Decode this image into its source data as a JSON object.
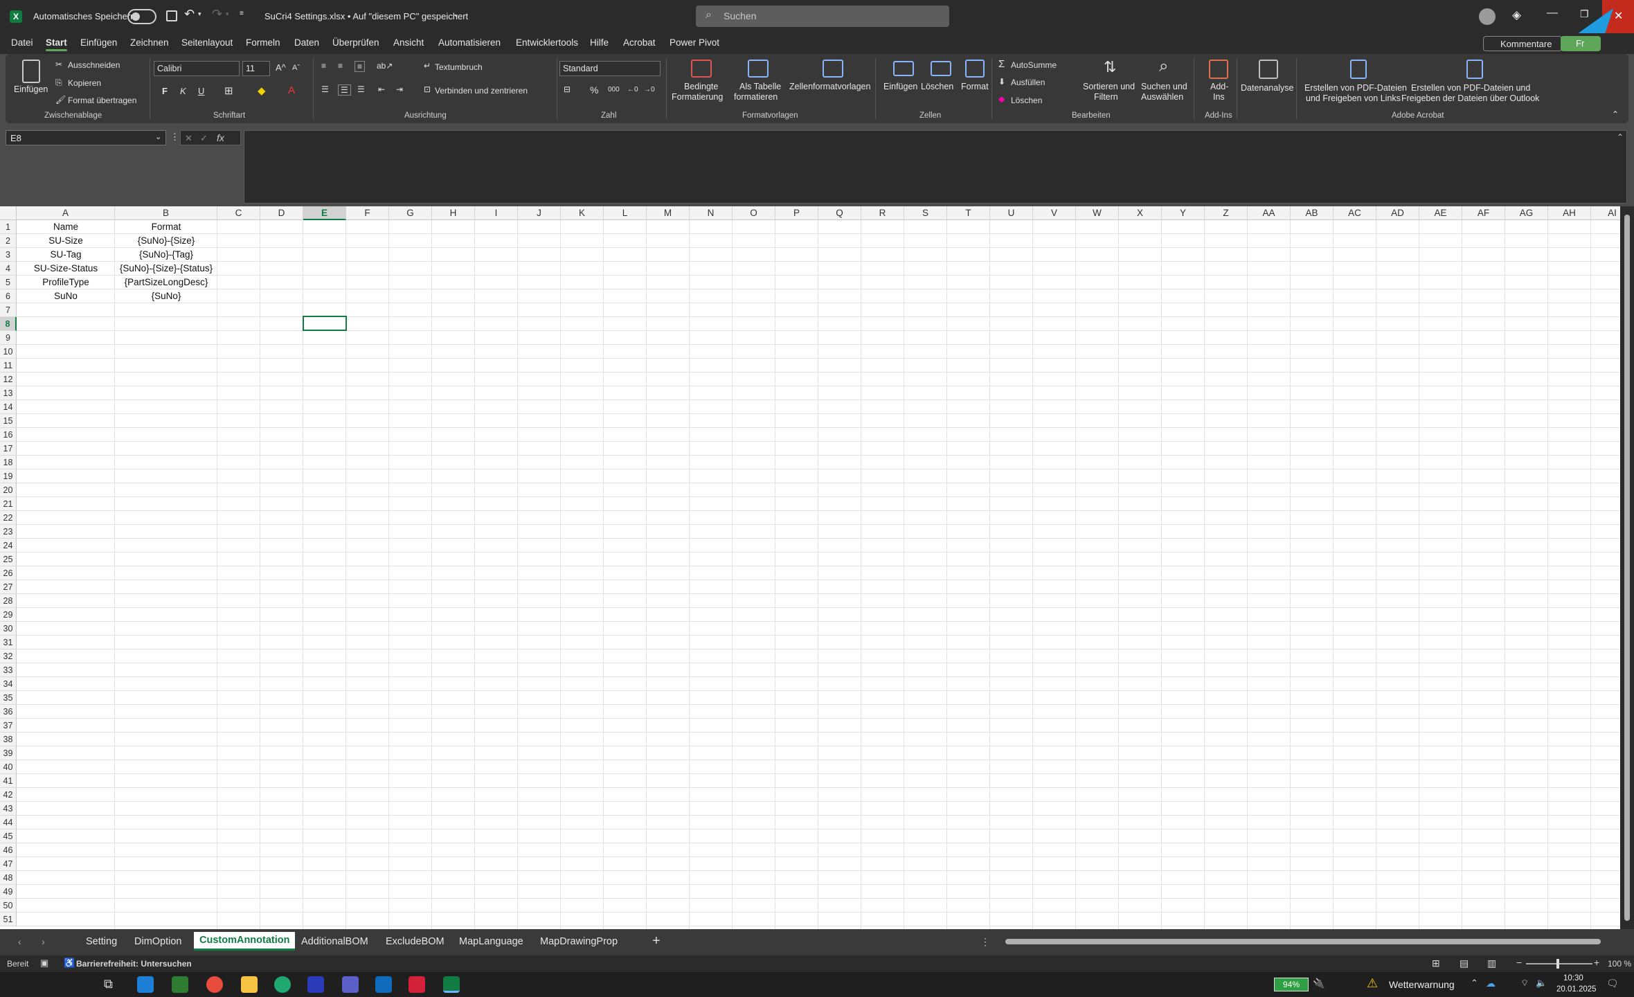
{
  "titlebar": {
    "autosave_label": "Automatisches Speichern",
    "file_title": "SuCri4 Settings.xlsx • Auf \"diesem PC\" gespeichert",
    "search_placeholder": "Suchen"
  },
  "menu": [
    "Datei",
    "Start",
    "Einfügen",
    "Zeichnen",
    "Seitenlayout",
    "Formeln",
    "Daten",
    "Überprüfen",
    "Ansicht",
    "Automatisieren",
    "Entwicklertools",
    "Hilfe",
    "Acrobat",
    "Power Pivot"
  ],
  "menu_active": "Start",
  "menu_right": {
    "comments": "Kommentare",
    "share": "Fr"
  },
  "ribbon": {
    "clipboard": {
      "paste": "Einfügen",
      "cut": "Ausschneiden",
      "copy": "Kopieren",
      "format_painter": "Format übertragen",
      "group": "Zwischenablage"
    },
    "font": {
      "name": "Calibri",
      "size": "11",
      "bold": "F",
      "italic": "K",
      "underline": "U",
      "group": "Schriftart"
    },
    "alignment": {
      "wrap": "Textumbruch",
      "merge": "Verbinden und zentrieren",
      "group": "Ausrichtung"
    },
    "number": {
      "format": "Standard",
      "group": "Zahl"
    },
    "styles": {
      "conditional_1": "Bedingte",
      "conditional_2": "Formatierung",
      "table_1": "Als Tabelle",
      "table_2": "formatieren",
      "cellstyles": "Zellenformatvorlagen",
      "group": "Formatvorlagen"
    },
    "cells": {
      "insert": "Einfügen",
      "delete": "Löschen",
      "format": "Format",
      "group": "Zellen"
    },
    "editing": {
      "autosum": "AutoSumme",
      "fill": "Ausfüllen",
      "clear": "Löschen",
      "sort_1": "Sortieren und",
      "sort_2": "Filtern",
      "find_1": "Suchen und",
      "find_2": "Auswählen",
      "group": "Bearbeiten"
    },
    "addins": {
      "addins_1": "Add-",
      "addins_2": "Ins",
      "group": "Add-Ins"
    },
    "analysis": {
      "label": "Datenanalyse"
    },
    "acrobat": {
      "pdf_links_1": "Erstellen von PDF-Dateien",
      "pdf_links_2": "und Freigeben von Links",
      "pdf_outlook_1": "Erstellen von PDF-Dateien und",
      "pdf_outlook_2": "Freigeben der Dateien über Outlook",
      "group": "Adobe Acrobat"
    }
  },
  "formula_bar": {
    "name_box": "E8",
    "fx": "fx",
    "content": ""
  },
  "columns": [
    "A",
    "B",
    "C",
    "D",
    "E",
    "F",
    "G",
    "H",
    "I",
    "J",
    "K",
    "L",
    "M",
    "N",
    "O",
    "P",
    "Q",
    "R",
    "S",
    "T",
    "U",
    "V",
    "W",
    "X",
    "Y",
    "Z",
    "AA",
    "AB",
    "AC",
    "AD",
    "AE",
    "AF",
    "AG",
    "AH",
    "AI"
  ],
  "selected_column": "E",
  "selected_row": "8",
  "rows": [
    "1",
    "2",
    "3",
    "4",
    "5",
    "6",
    "7",
    "8",
    "9",
    "10",
    "11",
    "12",
    "13",
    "14",
    "15",
    "16",
    "17",
    "18",
    "19",
    "20",
    "21",
    "22",
    "23",
    "24",
    "25",
    "26",
    "27",
    "28",
    "29",
    "30",
    "31",
    "32",
    "33",
    "34",
    "35",
    "36",
    "37",
    "38",
    "39",
    "40",
    "41",
    "42",
    "43",
    "44",
    "45",
    "46",
    "47",
    "48",
    "49",
    "50",
    "51"
  ],
  "cells": {
    "A": [
      "Name",
      "SU-Size",
      "SU-Tag",
      "SU-Size-Status",
      "ProfileType",
      "SuNo"
    ],
    "B": [
      "Format",
      "{SuNo}-{Size}",
      "{SuNo}-{Tag}",
      "{SuNo}-{Size}-{Status}",
      "{PartSizeLongDesc}",
      "{SuNo}"
    ]
  },
  "sheets": [
    "Setting",
    "DimOption",
    "CustomAnnotation",
    "AdditionalBOM",
    "ExcludeBOM",
    "MapLanguage",
    "MapDrawingProp"
  ],
  "active_sheet": "CustomAnnotation",
  "status": {
    "ready": "Bereit",
    "accessibility": "Barrierefreiheit: Untersuchen",
    "zoom": "100 %"
  },
  "taskbar": {
    "battery": "94%",
    "weather": "Wetterwarnung",
    "time": "10:30",
    "date": "20.01.2025"
  },
  "colors": {
    "excel_green": "#107c41",
    "close_red": "#c42b1c",
    "accent_blue": "#1f9de0"
  }
}
